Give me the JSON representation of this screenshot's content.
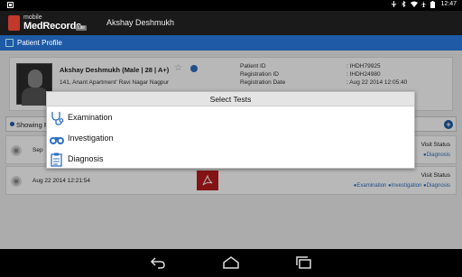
{
  "status_bar": {
    "time": "12:47",
    "icons": [
      "usb-icon",
      "bluetooth-icon",
      "wifi-icon",
      "airplane-icon",
      "battery-icon"
    ]
  },
  "header": {
    "logo_mobile": "mobile",
    "logo_name": "MedRecords",
    "logo_badge": "Lite",
    "user_name": "Akshay  Deshmukh"
  },
  "tab": {
    "label": "Patient Profile"
  },
  "profile": {
    "name": "Akshay  Deshmukh  (Male | 28 | A+)",
    "address": "141, Anant Apartment' Ravi Nagar Nagpur",
    "fields": [
      {
        "label": "Patient ID",
        "value": ": IHDH79925"
      },
      {
        "label": "Registration ID",
        "value": ": IHDH24980"
      },
      {
        "label": "Registration Date",
        "value": ": Aug 22 2014 12:05:40"
      }
    ]
  },
  "list": {
    "header_label": "Showing Re",
    "visits": [
      {
        "date": "Sep",
        "status_label": "Visit Status",
        "links": "●Diagnosis",
        "has_pdf": false
      },
      {
        "date": "Aug 22 2014 12:21:54",
        "status_label": "Visit Status",
        "links": "●Examination ●Investigation ●Diagnosis",
        "has_pdf": true
      }
    ]
  },
  "dialog": {
    "title": "Select Tests",
    "items": [
      {
        "label": "Examination",
        "icon": "stethoscope-icon"
      },
      {
        "label": "Investigation",
        "icon": "binoculars-icon"
      },
      {
        "label": "Diagnosis",
        "icon": "clipboard-icon"
      }
    ]
  },
  "nav": {
    "buttons": [
      "back-icon",
      "home-icon",
      "recent-apps-icon"
    ]
  },
  "colors": {
    "accent": "#1e5aa6",
    "link": "#2d6fc2",
    "pdf": "#b71c1c"
  }
}
